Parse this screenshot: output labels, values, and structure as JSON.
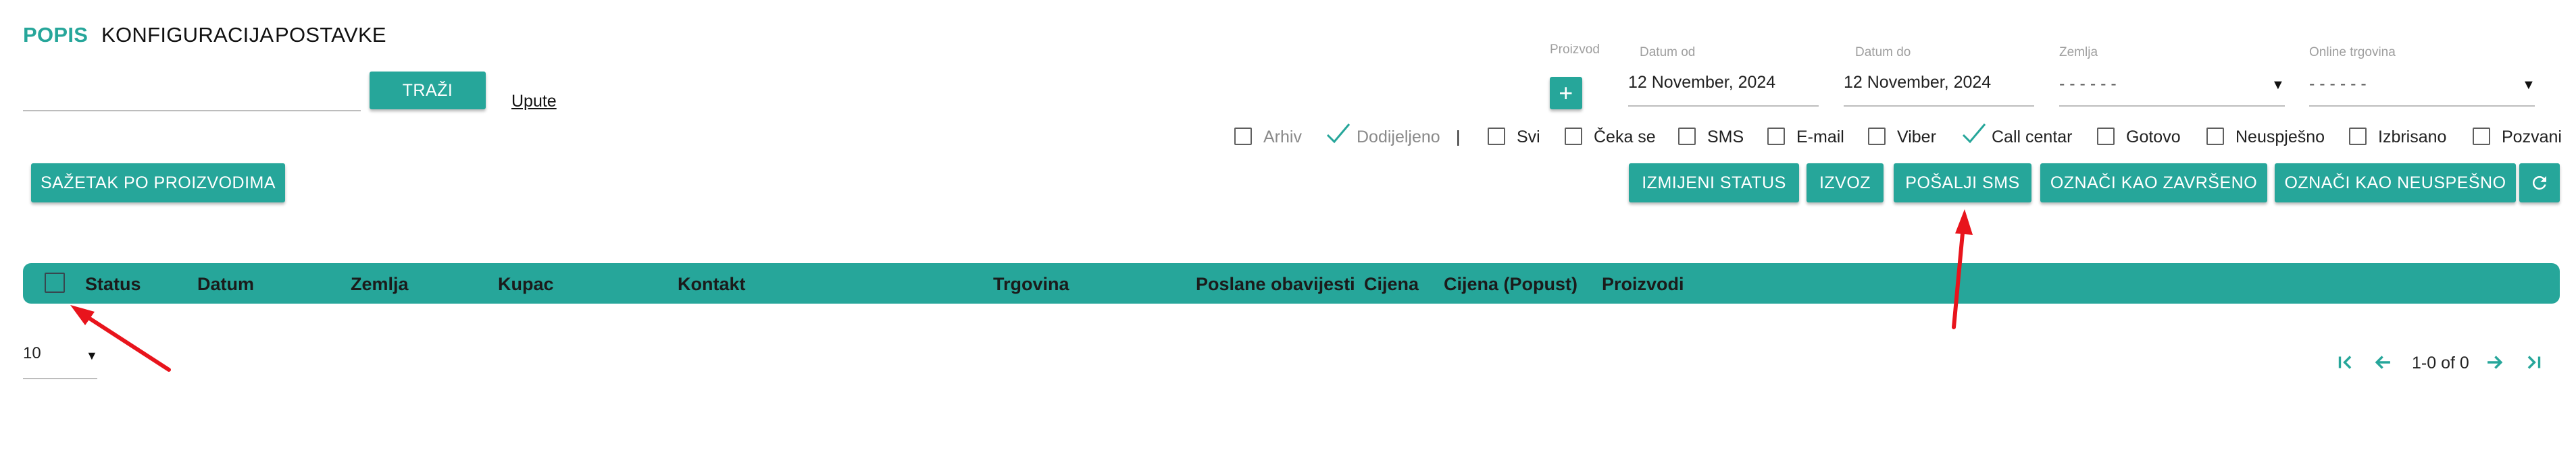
{
  "tabs": [
    {
      "label": "POPIS",
      "active": true
    },
    {
      "label": "KONFIGURACIJA",
      "active": false
    },
    {
      "label": "POSTAVKE",
      "active": false
    }
  ],
  "search": {
    "value": "",
    "button_label": "TRAŽI",
    "help_link": "Upute"
  },
  "filters": {
    "product_label": "Proizvod",
    "date_from_label": "Datum od",
    "date_from_value": "12 November, 2024",
    "date_to_label": "Datum do",
    "date_to_value": "12 November, 2024",
    "country_label": "Zemlja",
    "country_value": "- - - - - -",
    "shop_label": "Online trgovina",
    "shop_value": "- - - - - -"
  },
  "checkboxes": {
    "arhiv": {
      "label": "Arhiv",
      "checked": false
    },
    "dodijeljeno": {
      "label": "Dodijeljeno",
      "checked": true
    },
    "separator": "|",
    "svi": {
      "label": "Svi",
      "checked": false
    },
    "ceka_se": {
      "label": "Čeka se",
      "checked": false
    },
    "sms": {
      "label": "SMS",
      "checked": false
    },
    "email": {
      "label": "E-mail",
      "checked": false
    },
    "viber": {
      "label": "Viber",
      "checked": false
    },
    "call_centar": {
      "label": "Call centar",
      "checked": true
    },
    "gotovo": {
      "label": "Gotovo",
      "checked": false
    },
    "neuspjesno": {
      "label": "Neuspješno",
      "checked": false
    },
    "izbrisano": {
      "label": "Izbrisano",
      "checked": false
    },
    "pozvani": {
      "label": "Pozvani",
      "checked": false
    }
  },
  "actions": {
    "summary": "SAŽETAK PO PROIZVODIMA",
    "change_status": "IZMIJENI STATUS",
    "export": "IZVOZ",
    "send_sms": "POŠALJI SMS",
    "mark_done": "OZNAČI KAO ZAVRŠENO",
    "mark_failed": "OZNAČI KAO NEUSPEŠNO"
  },
  "table": {
    "columns": [
      "Status",
      "Datum",
      "Zemlja",
      "Kupac",
      "Kontakt",
      "Trgovina",
      "Poslane obavijesti",
      "Cijena",
      "Cijena (Popust)",
      "Proizvodi"
    ]
  },
  "pagination": {
    "rows_per_page": "10",
    "range_text": "1-0 of 0"
  },
  "colors": {
    "accent": "#26a69a",
    "annotation": "#e8141c"
  }
}
